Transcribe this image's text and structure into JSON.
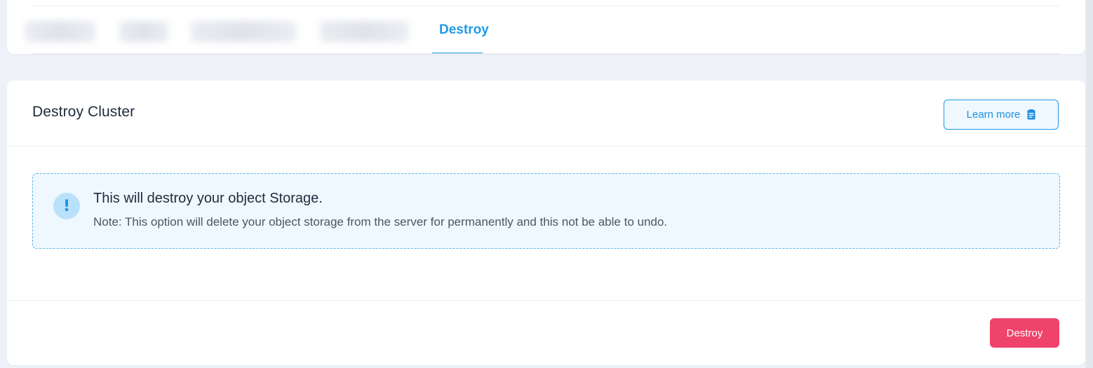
{
  "tabs": {
    "active_label": "Destroy",
    "accent_color": "#1e9be6"
  },
  "section": {
    "title": "Destroy Cluster",
    "learn_more_label": "Learn more"
  },
  "alert": {
    "icon": "exclamation-icon",
    "title": "This will destroy your object Storage.",
    "note": "Note: This option will delete your object storage from the server for permanently and this not be able to undo."
  },
  "footer": {
    "destroy_label": "Destroy",
    "destroy_color": "#f0436b"
  }
}
